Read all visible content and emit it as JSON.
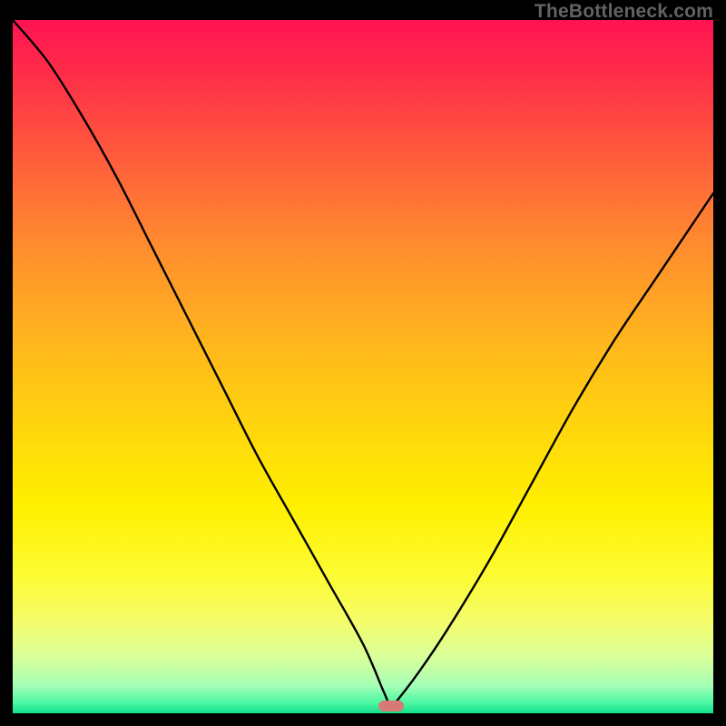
{
  "watermark": "TheBottleneck.com",
  "colors": {
    "frame_bg": "#000000",
    "curve_stroke": "#000000",
    "marker_fill": "#d77a75",
    "gradient_top": "#ff1352",
    "gradient_bottom": "#12e08a"
  },
  "chart_data": {
    "type": "line",
    "title": "",
    "xlabel": "",
    "ylabel": "",
    "xlim": [
      0,
      100
    ],
    "ylim": [
      0,
      100
    ],
    "grid": false,
    "legend": false,
    "curve_comment": "V-shaped bottleneck curve; y ≈ mismatch percentage, x ≈ relative component balance. Minimum near x≈54.",
    "series": [
      {
        "name": "bottleneck-curve",
        "x": [
          0,
          5,
          10,
          15,
          20,
          25,
          30,
          35,
          40,
          45,
          50,
          53,
          54,
          55,
          58,
          62,
          68,
          74,
          80,
          86,
          92,
          100
        ],
        "y": [
          100,
          94,
          86,
          77,
          67,
          57,
          47,
          37,
          28,
          19,
          10,
          3,
          1,
          2,
          6,
          12,
          22,
          33,
          44,
          54,
          63,
          75
        ]
      }
    ],
    "minimum_point": {
      "x": 54,
      "y": 1
    },
    "annotations": []
  },
  "marker": {
    "label": "",
    "shape": "pill"
  }
}
